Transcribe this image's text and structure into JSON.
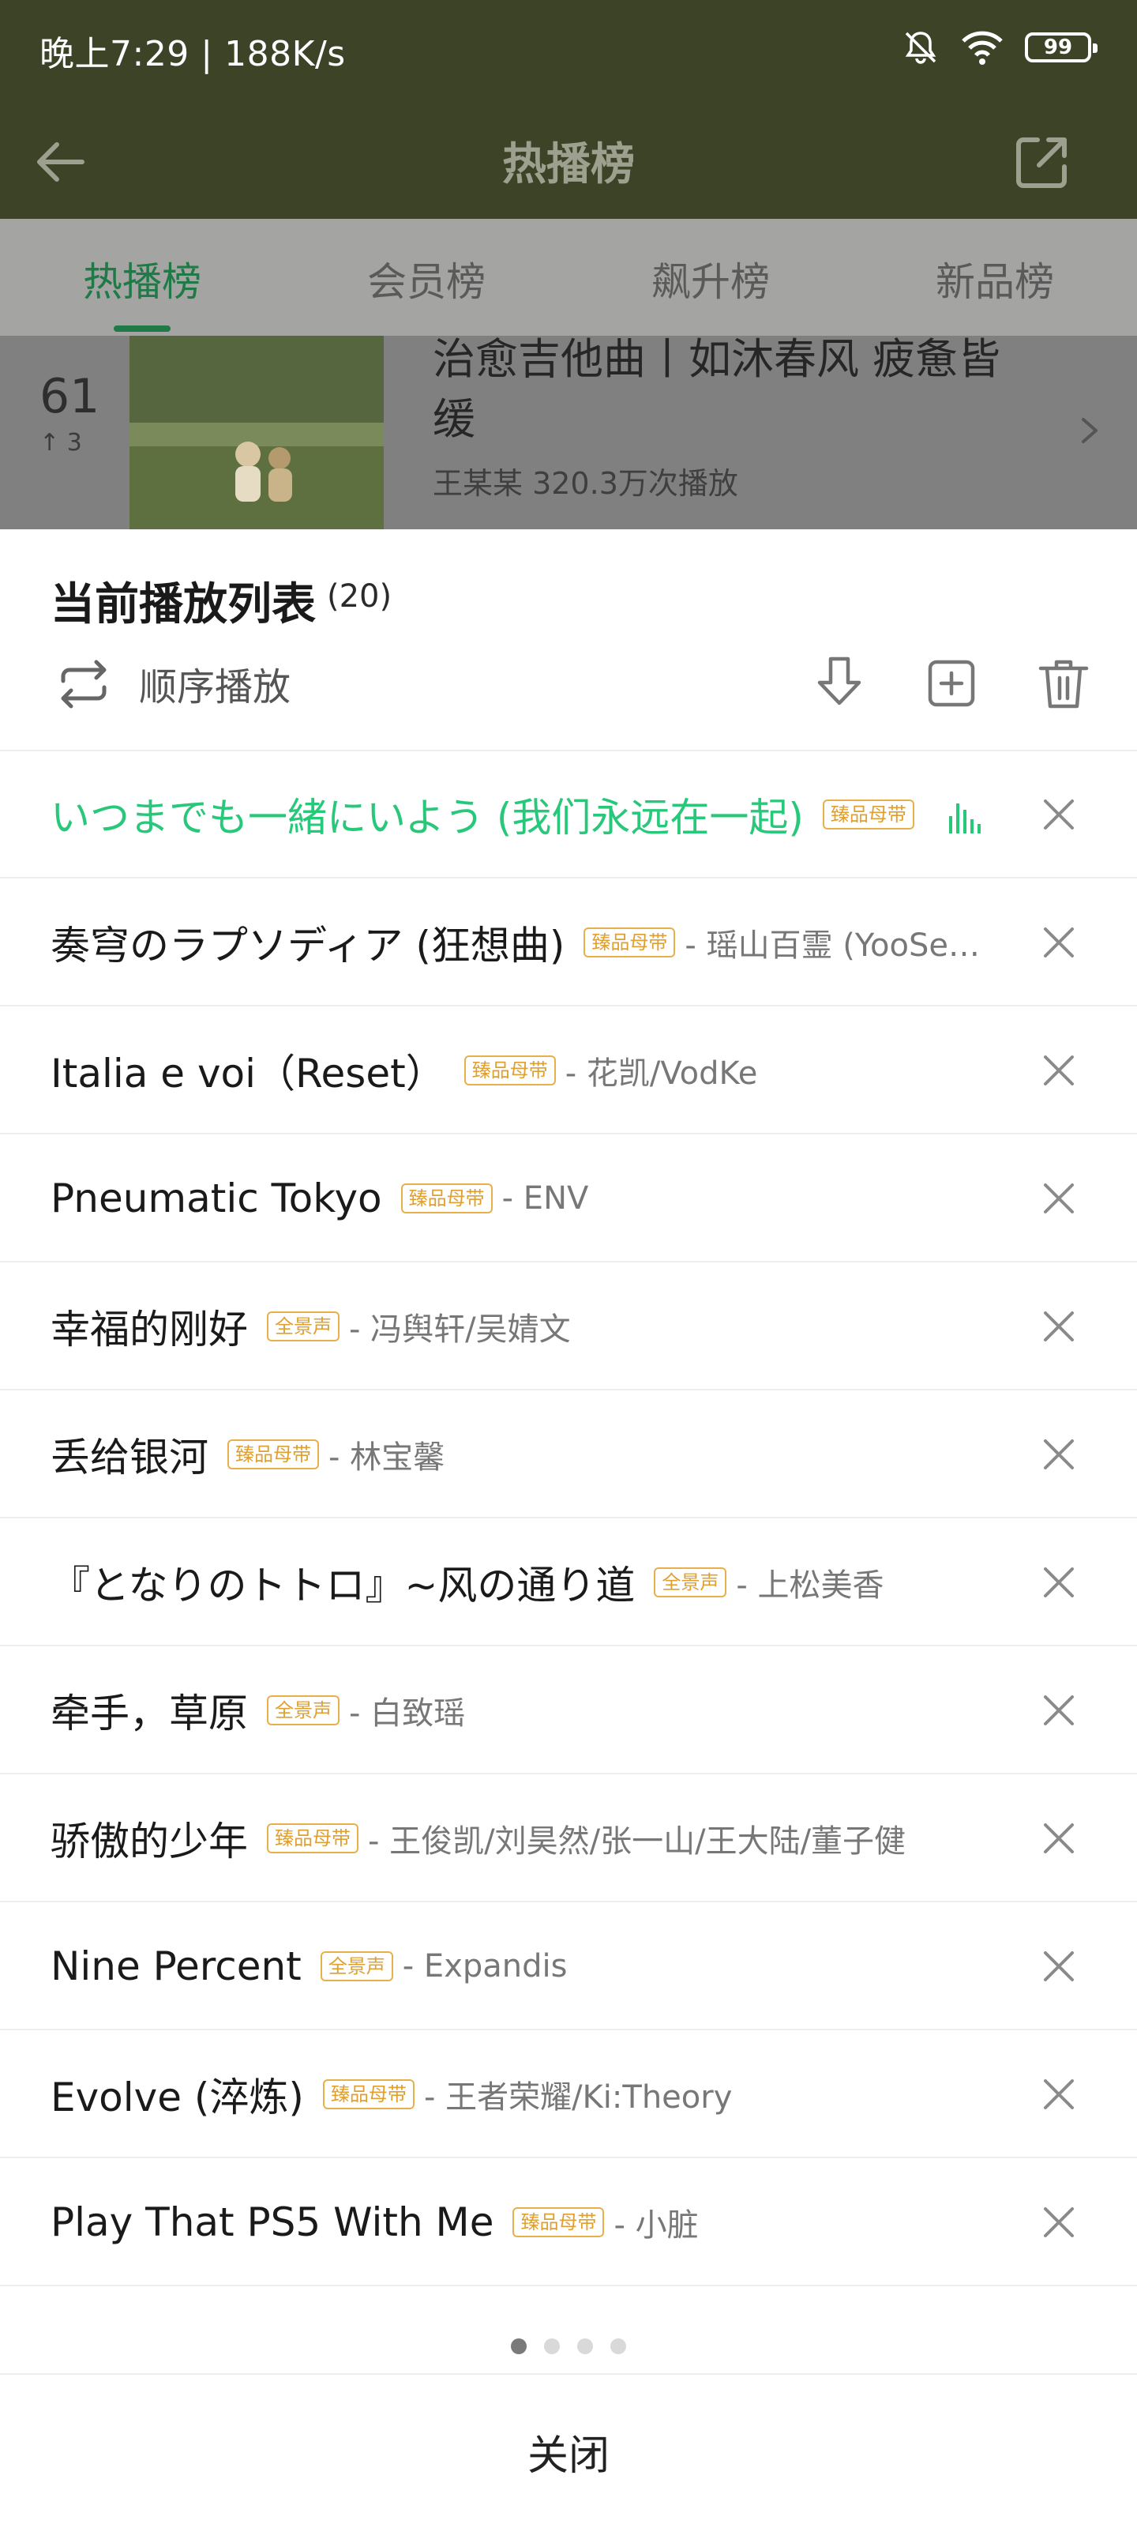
{
  "status_bar": {
    "time_speed": "晚上7:29 | 188K/s",
    "battery": "99",
    "icons": [
      "mute-bell-icon",
      "wifi-icon",
      "battery-icon"
    ]
  },
  "nav": {
    "title": "热播榜",
    "icons": [
      "back-arrow-icon",
      "share-icon"
    ]
  },
  "tabs": [
    {
      "label": "热播榜",
      "active": true
    },
    {
      "label": "会员榜",
      "active": false
    },
    {
      "label": "飙升榜",
      "active": false
    },
    {
      "label": "新品榜",
      "active": false
    }
  ],
  "chart_row": {
    "rank": "61",
    "change": "3",
    "title": "治愈吉他曲丨如沐春风 疲惫皆缓",
    "meta": "王某某  320.3万次播放"
  },
  "playlist": {
    "title": "当前播放列表",
    "count": "(20)",
    "play_mode": "顺序播放",
    "songs": [
      {
        "name": "いつまでも一緒にいよう (我们永远在一起)",
        "badge": "臻品母带",
        "artist": "",
        "playing": true
      },
      {
        "name": "奏穹のラプソディア (狂想曲)",
        "badge": "臻品母带",
        "artist": "- 瑶山百霊 (YooSeeTwins)",
        "playing": false
      },
      {
        "name": "Italia e voi（Reset）",
        "badge": "臻品母带",
        "artist": "- 花凯/VodKe",
        "playing": false
      },
      {
        "name": "Pneumatic Tokyo",
        "badge": "臻品母带",
        "artist": "- ENV",
        "playing": false
      },
      {
        "name": "幸福的刚好",
        "badge": "全景声",
        "artist": "- 冯舆轩/吴婧文",
        "playing": false
      },
      {
        "name": "丢给银河",
        "badge": "臻品母带",
        "artist": "- 林宝馨",
        "playing": false
      },
      {
        "name": "『となりのトトロ』~风の通り道",
        "badge": "全景声",
        "artist": "- 上松美香",
        "playing": false
      },
      {
        "name": "牵手，草原",
        "badge": "全景声",
        "artist": "- 白致瑶",
        "playing": false
      },
      {
        "name": "骄傲的少年",
        "badge": "臻品母带",
        "artist": "- 王俊凯/刘昊然/张一山/王大陆/董子健",
        "playing": false
      },
      {
        "name": "Nine Percent",
        "badge": "全景声",
        "artist": "- Expandis",
        "playing": false
      },
      {
        "name": "Evolve (淬炼)",
        "badge": "臻品母带",
        "artist": "- 王者荣耀/Ki:Theory",
        "playing": false
      },
      {
        "name": "Play That PS5 With Me",
        "badge": "臻品母带",
        "artist": "- 小脏",
        "playing": false
      }
    ]
  },
  "pager": {
    "total": 4,
    "active": 0
  },
  "close_label": "关闭",
  "colors": {
    "accent_green": "#28c87a",
    "badge_gold": "#e0a030"
  }
}
